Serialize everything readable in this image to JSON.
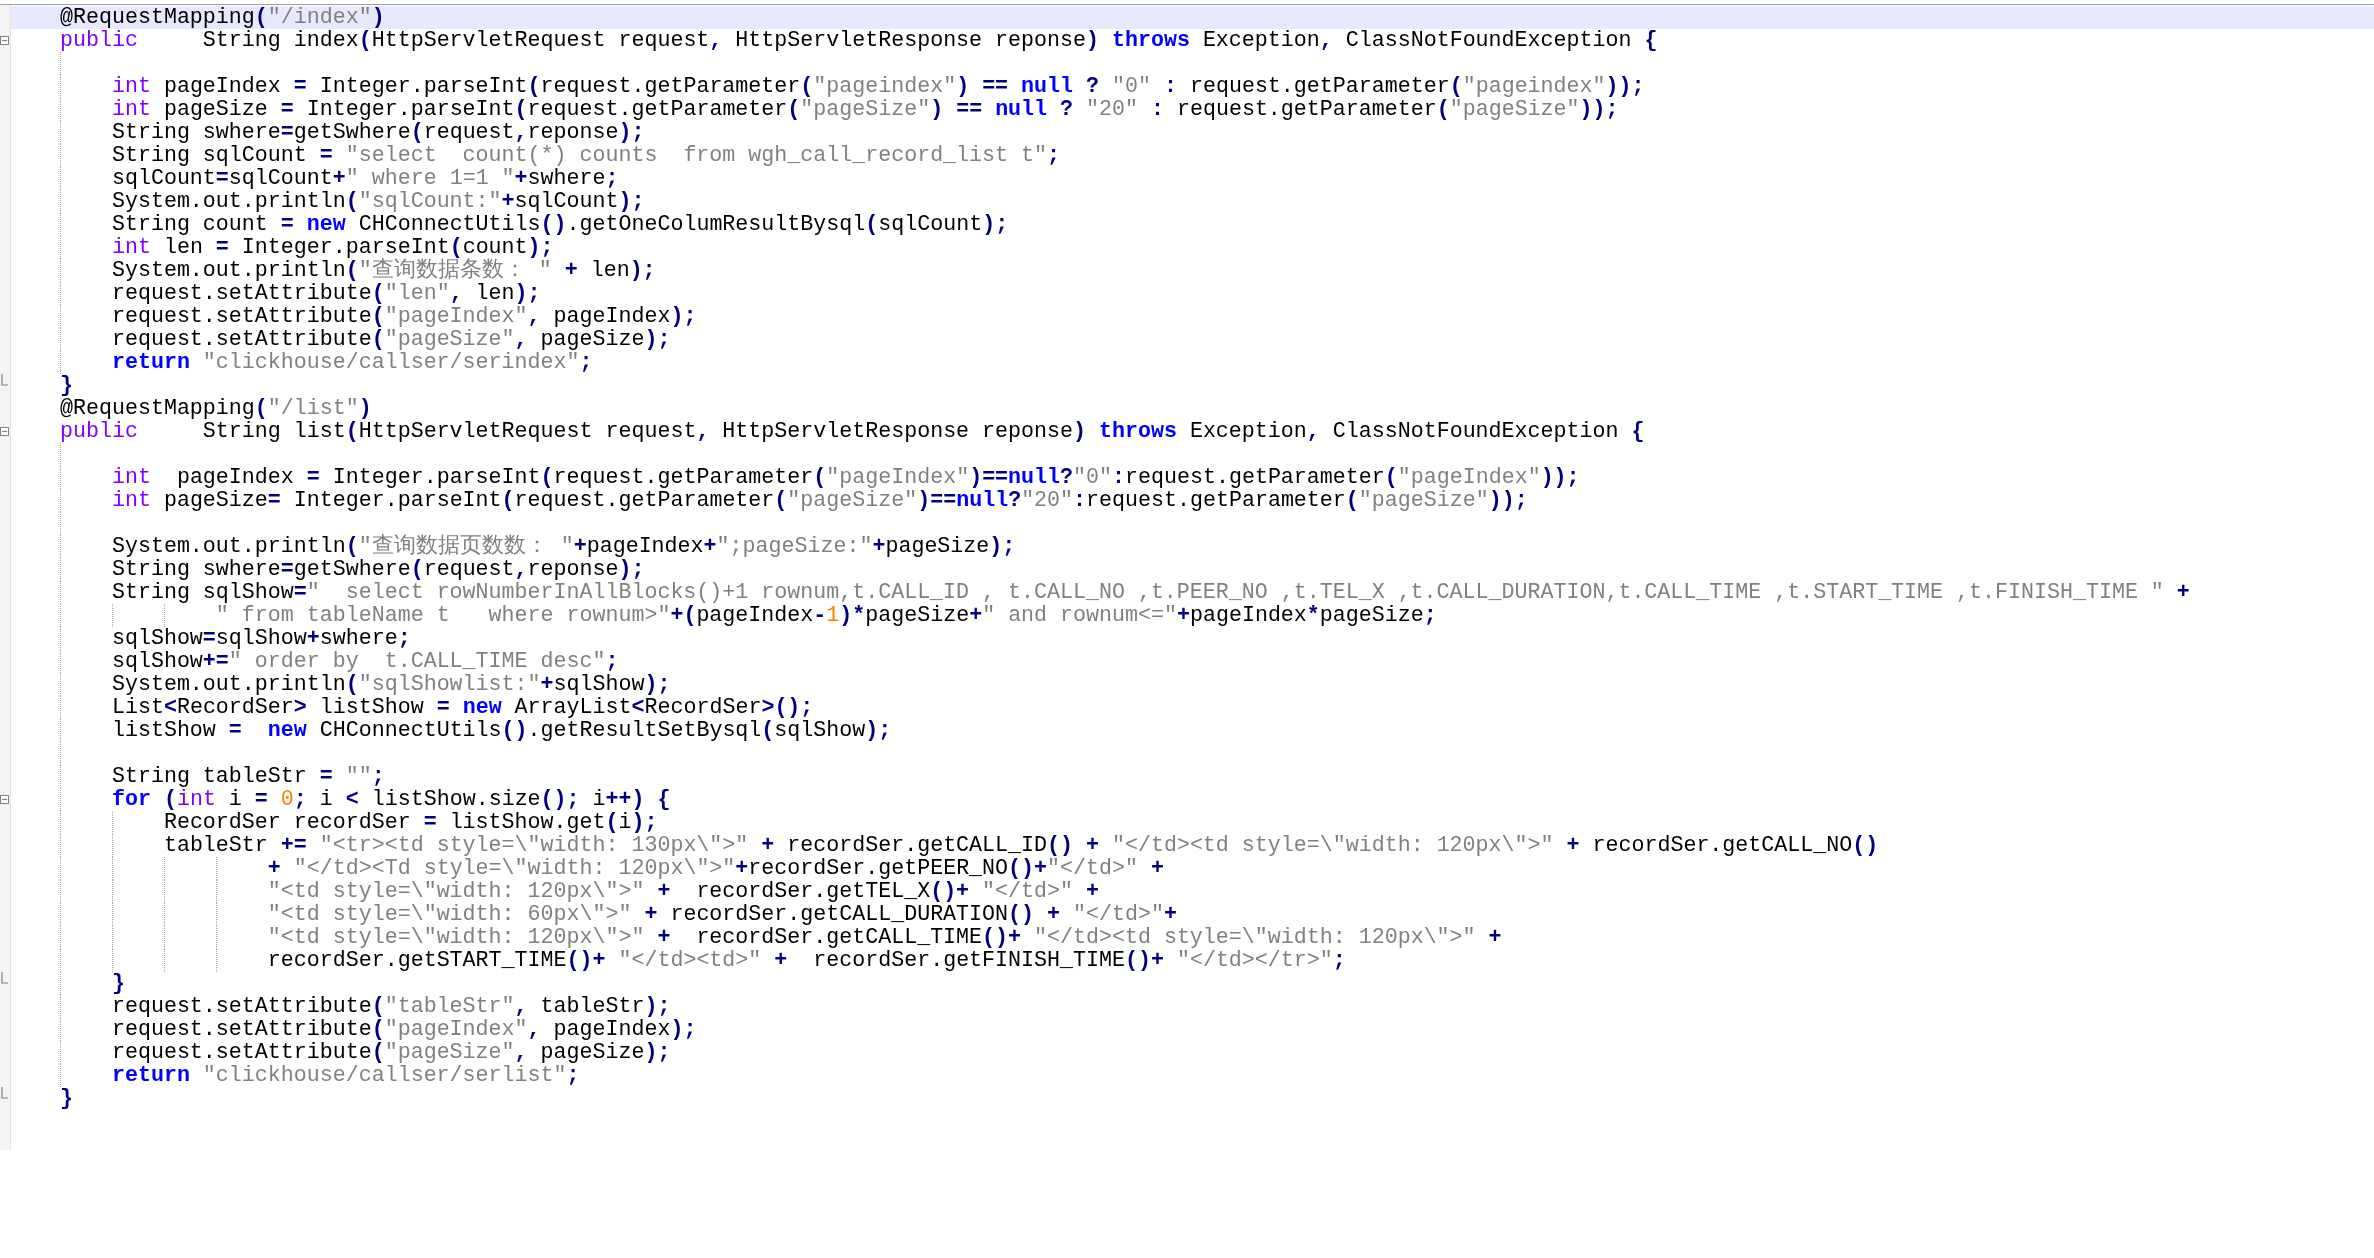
{
  "editor": {
    "lines": [
      {
        "current": true,
        "tokens": [
          {
            "kind": "plain",
            "text": "@RequestMapping"
          },
          {
            "kind": "op",
            "text": "("
          },
          {
            "kind": "string",
            "text": "\"/index\""
          },
          {
            "kind": "op",
            "text": ")"
          }
        ]
      },
      {
        "current": false,
        "fold": {
          "kind": "start",
          "expanded": true
        },
        "tokens": [
          {
            "kind": "type",
            "text": "public"
          },
          {
            "kind": "plain",
            "text": "     String index"
          },
          {
            "kind": "op",
            "text": "("
          },
          {
            "kind": "plain",
            "text": "HttpServletRequest request"
          },
          {
            "kind": "op",
            "text": ", "
          },
          {
            "kind": "plain",
            "text": "HttpServletResponse reponse"
          },
          {
            "kind": "op",
            "text": ") "
          },
          {
            "kind": "keyword",
            "text": "throws"
          },
          {
            "kind": "plain",
            "text": " Exception"
          },
          {
            "kind": "op",
            "text": ", "
          },
          {
            "kind": "plain",
            "text": "ClassNotFoundException "
          },
          {
            "kind": "op",
            "text": "{"
          }
        ]
      },
      {
        "current": false
      },
      {
        "current": false,
        "tokens": [
          {
            "kind": "type",
            "text": "    int"
          },
          {
            "kind": "plain",
            "text": " pageIndex "
          },
          {
            "kind": "op",
            "text": "= "
          },
          {
            "kind": "plain",
            "text": "Integer.parseInt"
          },
          {
            "kind": "op",
            "text": "("
          },
          {
            "kind": "plain",
            "text": "request.getParameter"
          },
          {
            "kind": "op",
            "text": "("
          },
          {
            "kind": "string",
            "text": "\"pageindex\""
          },
          {
            "kind": "op",
            "text": ") == "
          },
          {
            "kind": "keyword",
            "text": "null"
          },
          {
            "kind": "op",
            "text": " ? "
          },
          {
            "kind": "string",
            "text": "\"0\""
          },
          {
            "kind": "op",
            "text": " : "
          },
          {
            "kind": "plain",
            "text": "request.getParameter"
          },
          {
            "kind": "op",
            "text": "("
          },
          {
            "kind": "string",
            "text": "\"pageindex\""
          },
          {
            "kind": "op",
            "text": "));"
          }
        ]
      },
      {
        "current": false,
        "tokens": [
          {
            "kind": "type",
            "text": "    int"
          },
          {
            "kind": "plain",
            "text": " pageSize "
          },
          {
            "kind": "op",
            "text": "= "
          },
          {
            "kind": "plain",
            "text": "Integer.parseInt"
          },
          {
            "kind": "op",
            "text": "("
          },
          {
            "kind": "plain",
            "text": "request.getParameter"
          },
          {
            "kind": "op",
            "text": "("
          },
          {
            "kind": "string",
            "text": "\"pageSize\""
          },
          {
            "kind": "op",
            "text": ") == "
          },
          {
            "kind": "keyword",
            "text": "null"
          },
          {
            "kind": "op",
            "text": " ? "
          },
          {
            "kind": "string",
            "text": "\"20\""
          },
          {
            "kind": "op",
            "text": " : "
          },
          {
            "kind": "plain",
            "text": "request.getParameter"
          },
          {
            "kind": "op",
            "text": "("
          },
          {
            "kind": "string",
            "text": "\"pageSize\""
          },
          {
            "kind": "op",
            "text": "));"
          }
        ]
      },
      {
        "current": false,
        "tokens": [
          {
            "kind": "plain",
            "text": "    String swhere"
          },
          {
            "kind": "op",
            "text": "="
          },
          {
            "kind": "plain",
            "text": "getSwhere"
          },
          {
            "kind": "op",
            "text": "("
          },
          {
            "kind": "plain",
            "text": "request"
          },
          {
            "kind": "op",
            "text": ","
          },
          {
            "kind": "plain",
            "text": "reponse"
          },
          {
            "kind": "op",
            "text": ");"
          }
        ]
      },
      {
        "current": false,
        "tokens": [
          {
            "kind": "plain",
            "text": "    String sqlCount "
          },
          {
            "kind": "op",
            "text": "= "
          },
          {
            "kind": "string",
            "text": "\"select  count(*) counts  from wgh_call_record_list t\""
          },
          {
            "kind": "op",
            "text": ";"
          }
        ]
      },
      {
        "current": false,
        "tokens": [
          {
            "kind": "plain",
            "text": "    sqlCount"
          },
          {
            "kind": "op",
            "text": "="
          },
          {
            "kind": "plain",
            "text": "sqlCount"
          },
          {
            "kind": "op",
            "text": "+"
          },
          {
            "kind": "string",
            "text": "\" where 1=1 \""
          },
          {
            "kind": "op",
            "text": "+"
          },
          {
            "kind": "plain",
            "text": "swhere"
          },
          {
            "kind": "op",
            "text": ";"
          }
        ]
      },
      {
        "current": false,
        "tokens": [
          {
            "kind": "plain",
            "text": "    System.out.println"
          },
          {
            "kind": "op",
            "text": "("
          },
          {
            "kind": "string",
            "text": "\"sqlCount:\""
          },
          {
            "kind": "op",
            "text": "+"
          },
          {
            "kind": "plain",
            "text": "sqlCount"
          },
          {
            "kind": "op",
            "text": ");"
          }
        ]
      },
      {
        "current": false,
        "tokens": [
          {
            "kind": "plain",
            "text": "    String count "
          },
          {
            "kind": "op",
            "text": "= "
          },
          {
            "kind": "keyword",
            "text": "new"
          },
          {
            "kind": "plain",
            "text": " CHConnectUtils"
          },
          {
            "kind": "op",
            "text": "()"
          },
          {
            "kind": "plain",
            "text": ".getOneColumResultBysql"
          },
          {
            "kind": "op",
            "text": "("
          },
          {
            "kind": "plain",
            "text": "sqlCount"
          },
          {
            "kind": "op",
            "text": ");"
          }
        ]
      },
      {
        "current": false,
        "tokens": [
          {
            "kind": "type",
            "text": "    int"
          },
          {
            "kind": "plain",
            "text": " len "
          },
          {
            "kind": "op",
            "text": "= "
          },
          {
            "kind": "plain",
            "text": "Integer.parseInt"
          },
          {
            "kind": "op",
            "text": "("
          },
          {
            "kind": "plain",
            "text": "count"
          },
          {
            "kind": "op",
            "text": ");"
          }
        ]
      },
      {
        "current": false,
        "tokens": [
          {
            "kind": "plain",
            "text": "    System.out.println"
          },
          {
            "kind": "op",
            "text": "("
          },
          {
            "kind": "string",
            "text": "\"查询数据条数： \""
          },
          {
            "kind": "op",
            "text": " + "
          },
          {
            "kind": "plain",
            "text": "len"
          },
          {
            "kind": "op",
            "text": ");"
          }
        ]
      },
      {
        "current": false,
        "tokens": [
          {
            "kind": "plain",
            "text": "    request.setAttribute"
          },
          {
            "kind": "op",
            "text": "("
          },
          {
            "kind": "string",
            "text": "\"len\""
          },
          {
            "kind": "op",
            "text": ", "
          },
          {
            "kind": "plain",
            "text": "len"
          },
          {
            "kind": "op",
            "text": ");"
          }
        ]
      },
      {
        "current": false,
        "tokens": [
          {
            "kind": "plain",
            "text": "    request.setAttribute"
          },
          {
            "kind": "op",
            "text": "("
          },
          {
            "kind": "string",
            "text": "\"pageIndex\""
          },
          {
            "kind": "op",
            "text": ", "
          },
          {
            "kind": "plain",
            "text": "pageIndex"
          },
          {
            "kind": "op",
            "text": ");"
          }
        ]
      },
      {
        "current": false,
        "tokens": [
          {
            "kind": "plain",
            "text": "    request.setAttribute"
          },
          {
            "kind": "op",
            "text": "("
          },
          {
            "kind": "string",
            "text": "\"pageSize\""
          },
          {
            "kind": "op",
            "text": ", "
          },
          {
            "kind": "plain",
            "text": "pageSize"
          },
          {
            "kind": "op",
            "text": ");"
          }
        ]
      },
      {
        "current": false,
        "tokens": [
          {
            "kind": "keyword",
            "text": "    return "
          },
          {
            "kind": "string",
            "text": "\"clickhouse/callser/serindex\""
          },
          {
            "kind": "op",
            "text": ";"
          }
        ]
      },
      {
        "current": false,
        "fold": {
          "kind": "end"
        },
        "tokens": [
          {
            "kind": "op",
            "text": "}"
          }
        ]
      },
      {
        "current": false,
        "tokens": [
          {
            "kind": "plain",
            "text": "@RequestMapping"
          },
          {
            "kind": "op",
            "text": "("
          },
          {
            "kind": "string",
            "text": "\"/list\""
          },
          {
            "kind": "op",
            "text": ")"
          }
        ]
      },
      {
        "current": false,
        "fold": {
          "kind": "start",
          "expanded": true
        },
        "tokens": [
          {
            "kind": "type",
            "text": "public"
          },
          {
            "kind": "plain",
            "text": "     String list"
          },
          {
            "kind": "op",
            "text": "("
          },
          {
            "kind": "plain",
            "text": "HttpServletRequest request"
          },
          {
            "kind": "op",
            "text": ", "
          },
          {
            "kind": "plain",
            "text": "HttpServletResponse reponse"
          },
          {
            "kind": "op",
            "text": ") "
          },
          {
            "kind": "keyword",
            "text": "throws"
          },
          {
            "kind": "plain",
            "text": " Exception"
          },
          {
            "kind": "op",
            "text": ", "
          },
          {
            "kind": "plain",
            "text": "ClassNotFoundException "
          },
          {
            "kind": "op",
            "text": "{"
          }
        ]
      },
      {
        "current": false
      },
      {
        "current": false,
        "tokens": [
          {
            "kind": "type",
            "text": "    int"
          },
          {
            "kind": "plain",
            "text": "  pageIndex "
          },
          {
            "kind": "op",
            "text": "= "
          },
          {
            "kind": "plain",
            "text": "Integer.parseInt"
          },
          {
            "kind": "op",
            "text": "("
          },
          {
            "kind": "plain",
            "text": "request.getParameter"
          },
          {
            "kind": "op",
            "text": "("
          },
          {
            "kind": "string",
            "text": "\"pageIndex\""
          },
          {
            "kind": "op",
            "text": ")=="
          },
          {
            "kind": "keyword",
            "text": "null"
          },
          {
            "kind": "op",
            "text": "?"
          },
          {
            "kind": "string",
            "text": "\"0\""
          },
          {
            "kind": "op",
            "text": ":"
          },
          {
            "kind": "plain",
            "text": "request.getParameter"
          },
          {
            "kind": "op",
            "text": "("
          },
          {
            "kind": "string",
            "text": "\"pageIndex\""
          },
          {
            "kind": "op",
            "text": "));"
          }
        ]
      },
      {
        "current": false,
        "tokens": [
          {
            "kind": "type",
            "text": "    int"
          },
          {
            "kind": "plain",
            "text": " pageSize"
          },
          {
            "kind": "op",
            "text": "= "
          },
          {
            "kind": "plain",
            "text": "Integer.parseInt"
          },
          {
            "kind": "op",
            "text": "("
          },
          {
            "kind": "plain",
            "text": "request.getParameter"
          },
          {
            "kind": "op",
            "text": "("
          },
          {
            "kind": "string",
            "text": "\"pageSize\""
          },
          {
            "kind": "op",
            "text": ")=="
          },
          {
            "kind": "keyword",
            "text": "null"
          },
          {
            "kind": "op",
            "text": "?"
          },
          {
            "kind": "string",
            "text": "\"20\""
          },
          {
            "kind": "op",
            "text": ":"
          },
          {
            "kind": "plain",
            "text": "request.getParameter"
          },
          {
            "kind": "op",
            "text": "("
          },
          {
            "kind": "string",
            "text": "\"pageSize\""
          },
          {
            "kind": "op",
            "text": "));"
          }
        ]
      },
      {
        "current": false
      },
      {
        "current": false,
        "tokens": [
          {
            "kind": "plain",
            "text": "    System.out.println"
          },
          {
            "kind": "op",
            "text": "("
          },
          {
            "kind": "string",
            "text": "\"查询数据页数数： \""
          },
          {
            "kind": "op",
            "text": "+"
          },
          {
            "kind": "plain",
            "text": "pageIndex"
          },
          {
            "kind": "op",
            "text": "+"
          },
          {
            "kind": "string",
            "text": "\";pageSize:\""
          },
          {
            "kind": "op",
            "text": "+"
          },
          {
            "kind": "plain",
            "text": "pageSize"
          },
          {
            "kind": "op",
            "text": ");"
          }
        ]
      },
      {
        "current": false,
        "tokens": [
          {
            "kind": "plain",
            "text": "    String swhere"
          },
          {
            "kind": "op",
            "text": "="
          },
          {
            "kind": "plain",
            "text": "getSwhere"
          },
          {
            "kind": "op",
            "text": "("
          },
          {
            "kind": "plain",
            "text": "request"
          },
          {
            "kind": "op",
            "text": ","
          },
          {
            "kind": "plain",
            "text": "reponse"
          },
          {
            "kind": "op",
            "text": ");"
          }
        ]
      },
      {
        "current": false,
        "tokens": [
          {
            "kind": "plain",
            "text": "    String sqlShow"
          },
          {
            "kind": "op",
            "text": "="
          },
          {
            "kind": "string",
            "text": "\"  select rowNumberInAllBlocks()+1 rownum,t.CALL_ID , t.CALL_NO ,t.PEER_NO ,t.TEL_X ,t.CALL_DURATION,t.CALL_TIME ,t.START_TIME ,t.FINISH_TIME \""
          },
          {
            "kind": "op",
            "text": " +"
          }
        ]
      },
      {
        "current": false,
        "tokens": [
          {
            "kind": "string",
            "text": "            \" from tableName t   where rownum>\""
          },
          {
            "kind": "op",
            "text": "+("
          },
          {
            "kind": "plain",
            "text": "pageIndex"
          },
          {
            "kind": "op",
            "text": "-"
          },
          {
            "kind": "number",
            "text": "1"
          },
          {
            "kind": "op",
            "text": ")*"
          },
          {
            "kind": "plain",
            "text": "pageSize"
          },
          {
            "kind": "op",
            "text": "+"
          },
          {
            "kind": "string",
            "text": "\" and rownum<=\""
          },
          {
            "kind": "op",
            "text": "+"
          },
          {
            "kind": "plain",
            "text": "pageIndex"
          },
          {
            "kind": "op",
            "text": "*"
          },
          {
            "kind": "plain",
            "text": "pageSize"
          },
          {
            "kind": "op",
            "text": ";"
          }
        ]
      },
      {
        "current": false,
        "tokens": [
          {
            "kind": "plain",
            "text": "    sqlShow"
          },
          {
            "kind": "op",
            "text": "="
          },
          {
            "kind": "plain",
            "text": "sqlShow"
          },
          {
            "kind": "op",
            "text": "+"
          },
          {
            "kind": "plain",
            "text": "swhere"
          },
          {
            "kind": "op",
            "text": ";"
          }
        ]
      },
      {
        "current": false,
        "tokens": [
          {
            "kind": "plain",
            "text": "    sqlShow"
          },
          {
            "kind": "op",
            "text": "+="
          },
          {
            "kind": "string",
            "text": "\" order by  t.CALL_TIME desc\""
          },
          {
            "kind": "op",
            "text": ";"
          }
        ]
      },
      {
        "current": false,
        "tokens": [
          {
            "kind": "plain",
            "text": "    System.out.println"
          },
          {
            "kind": "op",
            "text": "("
          },
          {
            "kind": "string",
            "text": "\"sqlShowlist:\""
          },
          {
            "kind": "op",
            "text": "+"
          },
          {
            "kind": "plain",
            "text": "sqlShow"
          },
          {
            "kind": "op",
            "text": ");"
          }
        ]
      },
      {
        "current": false,
        "tokens": [
          {
            "kind": "plain",
            "text": "    List"
          },
          {
            "kind": "op",
            "text": "<"
          },
          {
            "kind": "plain",
            "text": "RecordSer"
          },
          {
            "kind": "op",
            "text": "> "
          },
          {
            "kind": "plain",
            "text": "listShow "
          },
          {
            "kind": "op",
            "text": "= "
          },
          {
            "kind": "keyword",
            "text": "new"
          },
          {
            "kind": "plain",
            "text": " ArrayList"
          },
          {
            "kind": "op",
            "text": "<"
          },
          {
            "kind": "plain",
            "text": "RecordSer"
          },
          {
            "kind": "op",
            "text": ">();"
          }
        ]
      },
      {
        "current": false,
        "tokens": [
          {
            "kind": "plain",
            "text": "    listShow "
          },
          {
            "kind": "op",
            "text": "=  "
          },
          {
            "kind": "keyword",
            "text": "new"
          },
          {
            "kind": "plain",
            "text": " CHConnectUtils"
          },
          {
            "kind": "op",
            "text": "()"
          },
          {
            "kind": "plain",
            "text": ".getResultSetBysql"
          },
          {
            "kind": "op",
            "text": "("
          },
          {
            "kind": "plain",
            "text": "sqlShow"
          },
          {
            "kind": "op",
            "text": ");"
          }
        ]
      },
      {
        "current": false
      },
      {
        "current": false,
        "tokens": [
          {
            "kind": "plain",
            "text": "    String tableStr "
          },
          {
            "kind": "op",
            "text": "= "
          },
          {
            "kind": "string",
            "text": "\"\""
          },
          {
            "kind": "op",
            "text": ";"
          }
        ]
      },
      {
        "current": false,
        "fold": {
          "kind": "start",
          "expanded": true
        },
        "tokens": [
          {
            "kind": "keyword",
            "text": "    for"
          },
          {
            "kind": "op",
            "text": " ("
          },
          {
            "kind": "type",
            "text": "int"
          },
          {
            "kind": "plain",
            "text": " i "
          },
          {
            "kind": "op",
            "text": "= "
          },
          {
            "kind": "number",
            "text": "0"
          },
          {
            "kind": "op",
            "text": "; "
          },
          {
            "kind": "plain",
            "text": "i "
          },
          {
            "kind": "op",
            "text": "< "
          },
          {
            "kind": "plain",
            "text": "listShow.size"
          },
          {
            "kind": "op",
            "text": "(); "
          },
          {
            "kind": "plain",
            "text": "i"
          },
          {
            "kind": "op",
            "text": "++) {"
          }
        ]
      },
      {
        "current": false,
        "tokens": [
          {
            "kind": "plain",
            "text": "        RecordSer recordSer "
          },
          {
            "kind": "op",
            "text": "= "
          },
          {
            "kind": "plain",
            "text": "listShow.get"
          },
          {
            "kind": "op",
            "text": "("
          },
          {
            "kind": "plain",
            "text": "i"
          },
          {
            "kind": "op",
            "text": ");"
          }
        ]
      },
      {
        "current": false,
        "tokens": [
          {
            "kind": "plain",
            "text": "        tableStr "
          },
          {
            "kind": "op",
            "text": "+= "
          },
          {
            "kind": "string",
            "text": "\"<tr><td style=\\\"width: 130px\\\">\""
          },
          {
            "kind": "op",
            "text": " + "
          },
          {
            "kind": "plain",
            "text": "recordSer.getCALL_ID"
          },
          {
            "kind": "op",
            "text": "() + "
          },
          {
            "kind": "string",
            "text": "\"</td><td style=\\\"width: 120px\\\">\""
          },
          {
            "kind": "op",
            "text": " + "
          },
          {
            "kind": "plain",
            "text": "recordSer.getCALL_NO"
          },
          {
            "kind": "op",
            "text": "()"
          }
        ]
      },
      {
        "current": false,
        "tokens": [
          {
            "kind": "op",
            "text": "                + "
          },
          {
            "kind": "string",
            "text": "\"</td><Td style=\\\"width: 120px\\\">\""
          },
          {
            "kind": "op",
            "text": "+"
          },
          {
            "kind": "plain",
            "text": "recordSer.getPEER_NO"
          },
          {
            "kind": "op",
            "text": "()+"
          },
          {
            "kind": "string",
            "text": "\"</td>\""
          },
          {
            "kind": "op",
            "text": " +"
          }
        ]
      },
      {
        "current": false,
        "tokens": [
          {
            "kind": "string",
            "text": "                \"<td style=\\\"width: 120px\\\">\""
          },
          {
            "kind": "op",
            "text": " +  "
          },
          {
            "kind": "plain",
            "text": "recordSer.getTEL_X"
          },
          {
            "kind": "op",
            "text": "()+ "
          },
          {
            "kind": "string",
            "text": "\"</td>\""
          },
          {
            "kind": "op",
            "text": " +"
          }
        ]
      },
      {
        "current": false,
        "tokens": [
          {
            "kind": "string",
            "text": "                \"<td style=\\\"width: 60px\\\">\""
          },
          {
            "kind": "op",
            "text": " + "
          },
          {
            "kind": "plain",
            "text": "recordSer.getCALL_DURATION"
          },
          {
            "kind": "op",
            "text": "() + "
          },
          {
            "kind": "string",
            "text": "\"</td>\""
          },
          {
            "kind": "op",
            "text": "+"
          }
        ]
      },
      {
        "current": false,
        "tokens": [
          {
            "kind": "string",
            "text": "                \"<td style=\\\"width: 120px\\\">\""
          },
          {
            "kind": "op",
            "text": " +  "
          },
          {
            "kind": "plain",
            "text": "recordSer.getCALL_TIME"
          },
          {
            "kind": "op",
            "text": "()+ "
          },
          {
            "kind": "string",
            "text": "\"</td><td style=\\\"width: 120px\\\">\""
          },
          {
            "kind": "op",
            "text": " +"
          }
        ]
      },
      {
        "current": false,
        "tokens": [
          {
            "kind": "plain",
            "text": "                recordSer.getSTART_TIME"
          },
          {
            "kind": "op",
            "text": "()+ "
          },
          {
            "kind": "string",
            "text": "\"</td><td>\""
          },
          {
            "kind": "op",
            "text": " +  "
          },
          {
            "kind": "plain",
            "text": "recordSer.getFINISH_TIME"
          },
          {
            "kind": "op",
            "text": "()+ "
          },
          {
            "kind": "string",
            "text": "\"</td></tr>\""
          },
          {
            "kind": "op",
            "text": ";"
          }
        ]
      },
      {
        "current": false,
        "fold": {
          "kind": "end"
        },
        "tokens": [
          {
            "kind": "op",
            "text": "    }"
          }
        ]
      },
      {
        "current": false,
        "tokens": [
          {
            "kind": "plain",
            "text": "    request.setAttribute"
          },
          {
            "kind": "op",
            "text": "("
          },
          {
            "kind": "string",
            "text": "\"tableStr\""
          },
          {
            "kind": "op",
            "text": ", "
          },
          {
            "kind": "plain",
            "text": "tableStr"
          },
          {
            "kind": "op",
            "text": ");"
          }
        ]
      },
      {
        "current": false,
        "tokens": [
          {
            "kind": "plain",
            "text": "    request.setAttribute"
          },
          {
            "kind": "op",
            "text": "("
          },
          {
            "kind": "string",
            "text": "\"pageIndex\""
          },
          {
            "kind": "op",
            "text": ", "
          },
          {
            "kind": "plain",
            "text": "pageIndex"
          },
          {
            "kind": "op",
            "text": ");"
          }
        ]
      },
      {
        "current": false,
        "tokens": [
          {
            "kind": "plain",
            "text": "    request.setAttribute"
          },
          {
            "kind": "op",
            "text": "("
          },
          {
            "kind": "string",
            "text": "\"pageSize\""
          },
          {
            "kind": "op",
            "text": ", "
          },
          {
            "kind": "plain",
            "text": "pageSize"
          },
          {
            "kind": "op",
            "text": ");"
          }
        ]
      },
      {
        "current": false,
        "tokens": [
          {
            "kind": "keyword",
            "text": "    return "
          },
          {
            "kind": "string",
            "text": "\"clickhouse/callser/serlist\""
          },
          {
            "kind": "op",
            "text": ";"
          }
        ]
      },
      {
        "current": false,
        "fold": {
          "kind": "end"
        },
        "tokens": [
          {
            "kind": "op",
            "text": "}"
          }
        ]
      }
    ]
  }
}
